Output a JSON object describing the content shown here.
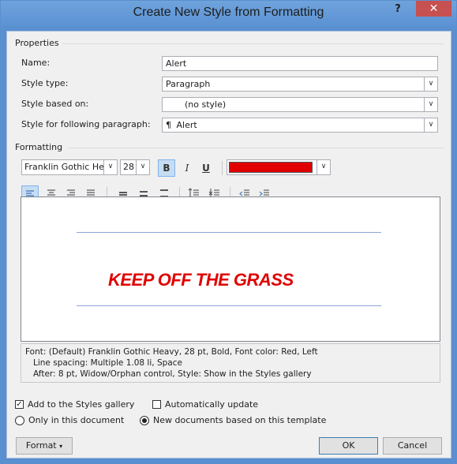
{
  "window": {
    "title": "Create New Style from Formatting",
    "help": "?",
    "close": "✕"
  },
  "properties": {
    "section_label": "Properties",
    "name_label": "Name:",
    "name_value": "Alert",
    "style_type_label": "Style type:",
    "style_type_value": "Paragraph",
    "based_on_label": "Style based on:",
    "based_on_value": "(no style)",
    "following_label": "Style for following paragraph:",
    "following_value": "Alert",
    "following_icon": "¶"
  },
  "formatting": {
    "section_label": "Formatting",
    "font_name": "Franklin Gothic He",
    "font_size": "28",
    "bold": "B",
    "italic": "I",
    "underline": "U",
    "font_color": "#e00000"
  },
  "preview": {
    "text": "KEEP OFF THE GRASS"
  },
  "description": {
    "line1": "Font: (Default) Franklin Gothic Heavy, 28 pt, Bold, Font color: Red, Left",
    "line2": "Line spacing:  Multiple 1.08 li, Space",
    "line3": "After:  8 pt, Widow/Orphan control, Style: Show in the Styles gallery"
  },
  "options": {
    "add_to_gallery": "Add to the Styles gallery",
    "add_to_gallery_checked": true,
    "auto_update": "Automatically update",
    "auto_update_checked": false,
    "only_this_doc": "Only in this document",
    "new_docs": "New documents based on this template",
    "selected_scope": "new_docs"
  },
  "buttons": {
    "format": "Format",
    "ok": "OK",
    "cancel": "Cancel"
  },
  "colors": {
    "accent": "#5b92d3",
    "close": "#c75050",
    "pressed": "#c7ddf3"
  }
}
